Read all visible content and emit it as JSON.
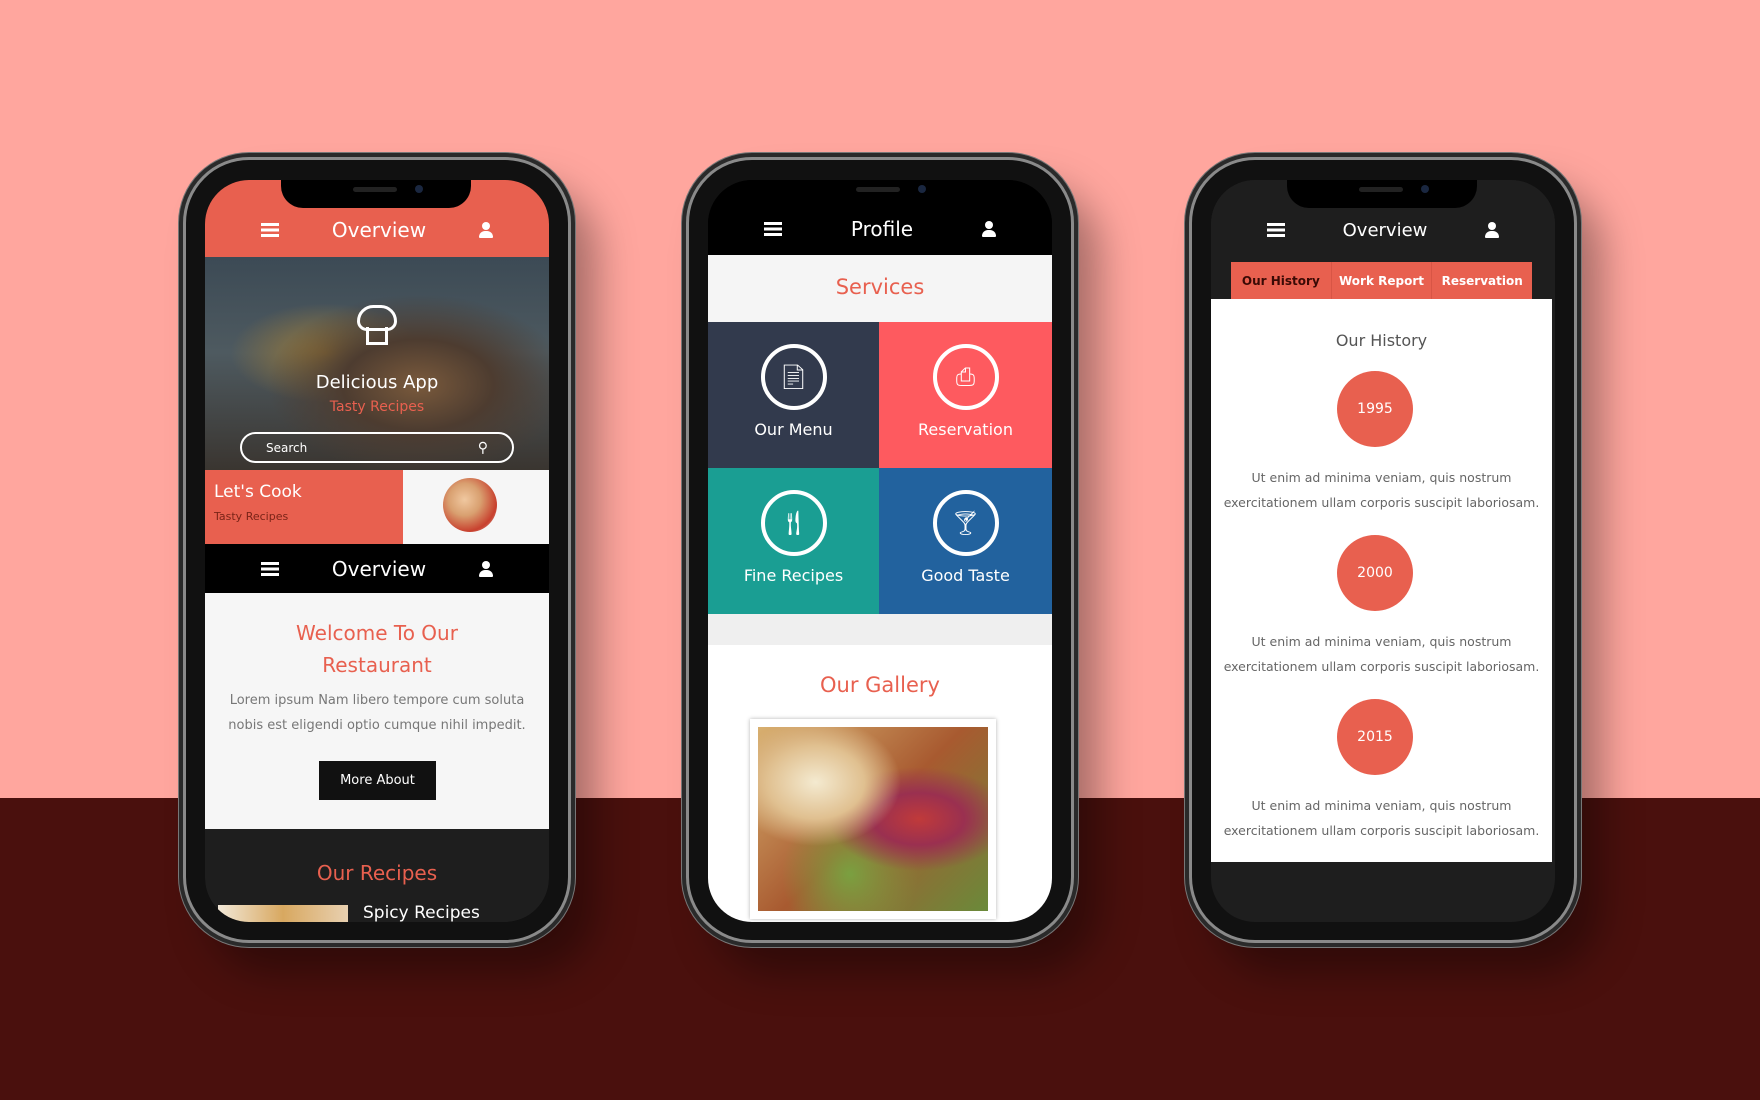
{
  "colors": {
    "background_top": "#ffa69e",
    "background_bottom": "#4a100d",
    "accent": "#e8604f",
    "dark": "#1e1e1e"
  },
  "phone1": {
    "header": {
      "title": "Overview",
      "menu_icon": "list-icon",
      "user_icon": "user-icon"
    },
    "hero": {
      "logo_icon": "chef-hat-icon",
      "title": "Delicious App",
      "subtitle": "Tasty Recipes",
      "search_placeholder": "Search",
      "search_icon": "search-icon"
    },
    "cook": {
      "title": "Let's Cook",
      "subtitle": "Tasty Recipes"
    },
    "nav": {
      "title": "Overview"
    },
    "welcome": {
      "title_line1": "Welcome To Our",
      "title_line2": "Restaurant",
      "line1": "Lorem ipsum Nam libero tempore cum soluta",
      "line2": "nobis est eligendi optio cumque nihil impedit.",
      "button": "More About"
    },
    "recipes": {
      "title": "Our Recipes",
      "item": "Spicy Recipes"
    }
  },
  "phone2": {
    "header": {
      "title": "Profile"
    },
    "services": {
      "title": "Services",
      "tiles": [
        {
          "label": "Our Menu",
          "icon": "file-icon",
          "color": "#323a4d"
        },
        {
          "label": "Reservation",
          "icon": "printer-icon",
          "color": "#fe5a5f"
        },
        {
          "label": "Fine Recipes",
          "icon": "cutlery-icon",
          "color": "#1a9e93"
        },
        {
          "label": "Good Taste",
          "icon": "cocktail-icon",
          "color": "#22629e"
        }
      ]
    },
    "gallery": {
      "title": "Our Gallery"
    }
  },
  "phone3": {
    "header": {
      "title": "Overview"
    },
    "tabs": [
      {
        "label": "Our History",
        "active": true
      },
      {
        "label": "Work Report",
        "active": false
      },
      {
        "label": "Reservation",
        "active": false
      }
    ],
    "history": {
      "title": "Our History",
      "items": [
        {
          "year": "1995",
          "line1": "Ut enim ad minima veniam, quis nostrum",
          "line2": "exercitationem ullam corporis suscipit laboriosam."
        },
        {
          "year": "2000",
          "line1": "Ut enim ad minima veniam, quis nostrum",
          "line2": "exercitationem ullam corporis suscipit laboriosam."
        },
        {
          "year": "2015",
          "line1": "Ut enim ad minima veniam, quis nostrum",
          "line2": "exercitationem ullam corporis suscipit laboriosam."
        }
      ]
    }
  }
}
